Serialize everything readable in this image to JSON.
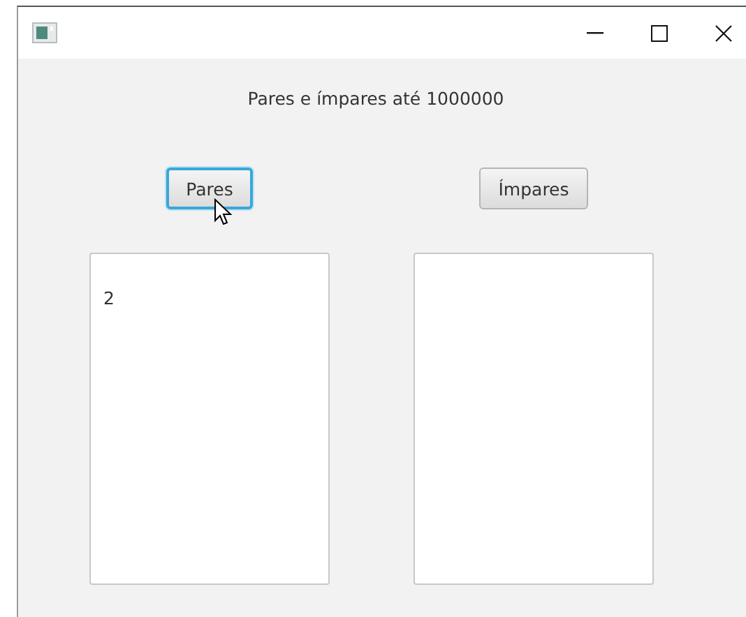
{
  "heading": "Pares e ímpares até 1000000",
  "columns": [
    {
      "button": {
        "label": "Pares",
        "focused": true,
        "hovered": true
      },
      "list": {
        "lines": [
          "2"
        ]
      }
    },
    {
      "button": {
        "label": "Ímpares",
        "focused": false,
        "hovered": false
      }
    }
  ]
}
